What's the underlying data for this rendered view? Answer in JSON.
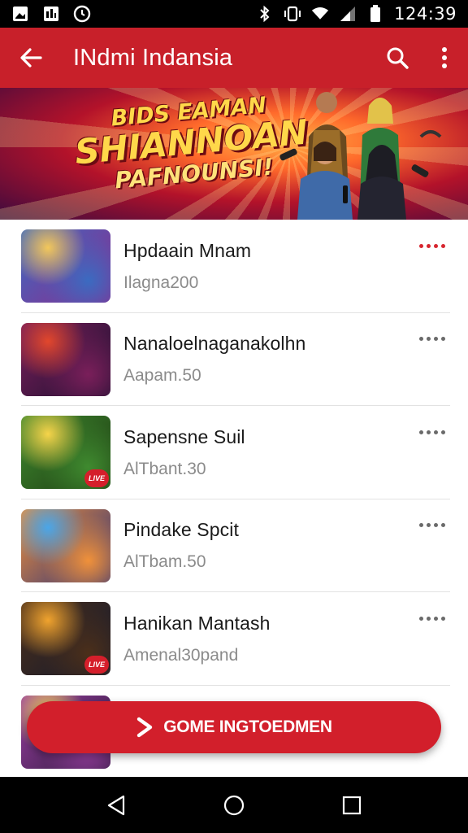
{
  "status_bar": {
    "time": "124:39"
  },
  "app_bar": {
    "title": "INdmi Indansia"
  },
  "banner": {
    "line1": "BIDS EAMAN",
    "line2": "SHIANNOAN",
    "line3": "PAFNOUNSI!"
  },
  "games": [
    {
      "title": "Hpdaain Mnam",
      "subtitle": "Ilagna200",
      "badge": "",
      "menu_accent": true,
      "colors": [
        "#f2c75b",
        "#3b6bc1",
        "#8e2a8d"
      ]
    },
    {
      "title": "Nanaloelnaganakolhn",
      "subtitle": "Aapam.50",
      "badge": "",
      "menu_accent": false,
      "colors": [
        "#e2472c",
        "#7a1f5a",
        "#1b1030"
      ]
    },
    {
      "title": "Sapensne Suil",
      "subtitle": "AlΤbant.30",
      "badge": "LIVE",
      "menu_accent": false,
      "colors": [
        "#f6d44a",
        "#3f8a2f",
        "#1d3a12"
      ]
    },
    {
      "title": "Pindake Spcit",
      "subtitle": "AlΤbam.50",
      "badge": "",
      "menu_accent": false,
      "colors": [
        "#4aa6e8",
        "#f0913a",
        "#2a2f7a"
      ]
    },
    {
      "title": "Hanikan Mantash",
      "subtitle": "Amenal30pand",
      "badge": "LIVE",
      "menu_accent": false,
      "colors": [
        "#f0a32e",
        "#4b2f1a",
        "#151a2e"
      ]
    },
    {
      "title": "",
      "subtitle": "",
      "badge": "",
      "menu_accent": false,
      "colors": [
        "#f3d35a",
        "#9b3fa3",
        "#2c1a3a"
      ]
    }
  ],
  "cta": {
    "label": "GOME INGTOEDMEN"
  },
  "icons": {
    "status": [
      "image-icon",
      "photo-icon",
      "clock-icon",
      "bluetooth-icon",
      "vibrate-icon",
      "wifi-icon",
      "signal-icon",
      "battery-icon"
    ],
    "app_bar": [
      "back-arrow-icon",
      "search-icon",
      "more-vert-icon"
    ],
    "nav": [
      "nav-back-icon",
      "nav-home-icon",
      "nav-recents-icon"
    ]
  },
  "colors": {
    "brand": "#c8202a",
    "accent": "#d21f2b"
  }
}
